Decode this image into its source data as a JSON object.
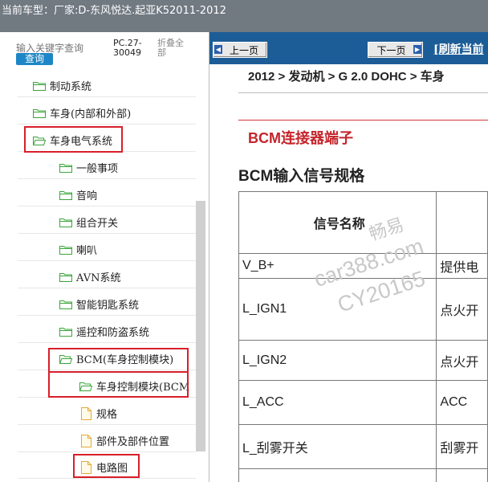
{
  "topbar": {
    "label": "当前车型：",
    "value": "厂家:D-东风悦达.起亚K52011-2012"
  },
  "sidebar": {
    "search_placeholder": "输入关键字查询",
    "query_button": "查询",
    "pc_code": "PC.27-\n30049",
    "collapse_all": "折叠全部",
    "items": [
      {
        "label": "制动系统",
        "icon": "folder-icon",
        "level": 1,
        "highlighted": false
      },
      {
        "label": "车身(内部和外部)",
        "icon": "folder-icon",
        "level": 1,
        "highlighted": false
      },
      {
        "label": "车身电气系统",
        "icon": "folder-open-icon",
        "level": 1,
        "highlighted": true
      },
      {
        "label": "一般事项",
        "icon": "folder-icon",
        "level": 2,
        "highlighted": false
      },
      {
        "label": "音响",
        "icon": "folder-icon",
        "level": 2,
        "highlighted": false
      },
      {
        "label": "组合开关",
        "icon": "folder-icon",
        "level": 2,
        "highlighted": false
      },
      {
        "label": "喇叭",
        "icon": "folder-icon",
        "level": 2,
        "highlighted": false
      },
      {
        "label": "AVN系统",
        "icon": "folder-icon",
        "level": 2,
        "highlighted": false
      },
      {
        "label": "智能钥匙系统",
        "icon": "folder-icon",
        "level": 2,
        "highlighted": false
      },
      {
        "label": "遥控和防盗系统",
        "icon": "folder-icon",
        "level": 2,
        "highlighted": false
      },
      {
        "label": "BCM(车身控制模块)",
        "icon": "folder-open-icon",
        "level": 2,
        "highlighted": true
      },
      {
        "label": "车身控制模块(BCM",
        "icon": "folder-open-icon",
        "level": 3,
        "highlighted": true
      },
      {
        "label": "规格",
        "icon": "document-icon",
        "level": 4,
        "highlighted": false
      },
      {
        "label": "部件及部件位置",
        "icon": "document-icon",
        "level": 4,
        "highlighted": false
      },
      {
        "label": "电路图",
        "icon": "document-icon",
        "level": 4,
        "highlighted": true
      }
    ]
  },
  "content": {
    "prev_button": "上一页",
    "next_button": "下一页",
    "refresh_link": "[刷新当前",
    "breadcrumb": "2012 > 发动机 > G 2.0 DOHC > 车身",
    "section_title": "BCM连接器端子",
    "table_title": "BCM输入信号规格",
    "table": {
      "headers": [
        "信号名称",
        ""
      ],
      "rows": [
        [
          "V_B+",
          "提供电"
        ],
        [
          "L_IGN1",
          "点火开"
        ],
        [
          "L_IGN2",
          "点火开"
        ],
        [
          "L_ACC",
          "ACC"
        ],
        [
          "L_刮雾开关",
          "刮雾开"
        ],
        [
          "",
          ""
        ]
      ]
    },
    "watermark": {
      "line1": "畅易",
      "line2": "car388.com",
      "line3": "CY20165"
    }
  },
  "colors": {
    "topbar_bg": "#717981",
    "nav_bg": "#1d5d97",
    "accent_red": "#d81f2a",
    "query_btn": "#1e86c6"
  }
}
